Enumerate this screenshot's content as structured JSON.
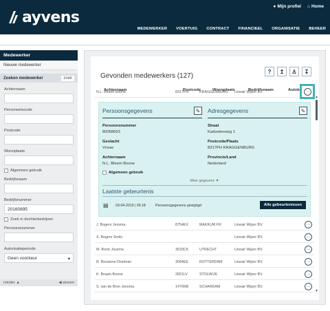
{
  "brand": {
    "name": "ayvens"
  },
  "top_links": {
    "profile": "Mijn profiel",
    "home": "Home"
  },
  "nav": [
    "MEDEWERKER",
    "VOERTUIG",
    "CONTRACT",
    "FINANCIEEL",
    "ORGANISATIE",
    "BEHEER"
  ],
  "sidebar": {
    "title": "Medewerker",
    "new_item": "Nieuwe medewerker",
    "search_label": "Zoeken medewerker",
    "zoek": "zoek",
    "fields": {
      "achternaam": "Achternaam",
      "personeelscode": "Personeelscode",
      "postcode": "Postcode",
      "woonplaats": "Woonplaats",
      "algemeen_gebruik": "Algemeen gebruik",
      "bedrijfsnaam": "Bedrijfsnaam",
      "bedrijfsnummer": "Bedrijfsnummer",
      "bedrijfsnummer_value": "20160895",
      "zoek_dochter": "Zoek in dochterbedrijven",
      "persoonsnummer": "Persoonsnummer",
      "autorisatieperiode": "Autorisatieperiode",
      "autorisatie_value": "Geen voorkeur"
    },
    "footer_left": "minder",
    "footer_right": "wissen"
  },
  "panel": {
    "title": "Gevonden medewerkers (127)",
    "columns": [
      "Achternaam",
      "Postcode",
      "Woonplaats",
      "Bedrijfsnaam",
      "Autokeuze"
    ],
    "first_row": [
      "N.L. Bloem Boone",
      "8317PH",
      "KRAGGENBURG",
      "Lineair Wijzer BV."
    ],
    "detail": {
      "persoonsgegevens": "Persoonsgegevens",
      "adresgegevens": "Adresgegevens",
      "persoonsnummer_label": "Persoonsnummer",
      "persoonsnummer_value": "80058663",
      "geslacht_label": "Geslacht",
      "geslacht_value": "Vrouw",
      "achternaam_label": "Achternaam",
      "achternaam_value": "N.L.   Bloem Boone",
      "algemeen_gebruik": "Algemeen gebruik",
      "straat_label": "Straat",
      "straat_value": "Kadoelenweg 1",
      "postcode_label": "Postcode/Plaats",
      "postcode_value": "8317PH KRAGGENBURG",
      "provincie_label": "Provincie/Land",
      "provincie_value": "Nederland",
      "meer": "Meer gegevens",
      "laatste": "Laatste gebeurtenis",
      "event_date": "03-04-2019 | 09:18",
      "event_text": "Persoonsgegevens gewijzigd",
      "alle_button": "Alle gebeurtenissen"
    },
    "rows": [
      [
        "J. Bogers Jensma",
        "8754EX",
        "MAKKUM FR",
        "Lineair Wijzer BV."
      ],
      [
        "X. Bogers Smits",
        "",
        "",
        "Lineair Wijzer BV."
      ],
      [
        "M. Borst Jousma",
        "3533CK",
        "UTRECHT",
        "Lineair Wijzer BV."
      ],
      [
        "R. Bouwens Doelman",
        "3044EE",
        "ROTTERDAM",
        "Lineair Wijzer BV."
      ],
      [
        "K. Braam Boone",
        "2821LV",
        "STOLWIJK",
        "Lineair Wijzer BV."
      ],
      [
        "S. van de Bron Jensma",
        "1476NB",
        "SCHARDAM",
        "Lineair Wijzer BV."
      ]
    ]
  }
}
